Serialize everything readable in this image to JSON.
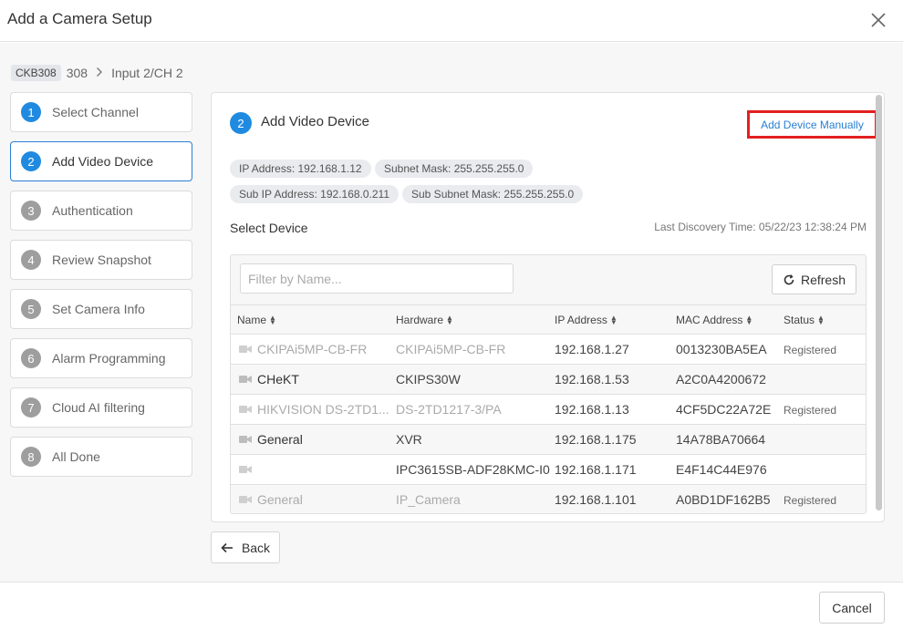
{
  "dialog": {
    "title": "Add a Camera Setup",
    "close_icon": "close-icon"
  },
  "breadcrumb": {
    "chip": "CKB308",
    "device": "308",
    "channel": "Input 2/CH 2"
  },
  "steps": [
    {
      "num": "1",
      "label": "Select Channel",
      "state": "done"
    },
    {
      "num": "2",
      "label": "Add Video Device",
      "state": "active"
    },
    {
      "num": "3",
      "label": "Authentication",
      "state": "pending"
    },
    {
      "num": "4",
      "label": "Review Snapshot",
      "state": "pending"
    },
    {
      "num": "5",
      "label": "Set Camera Info",
      "state": "pending"
    },
    {
      "num": "6",
      "label": "Alarm Programming",
      "state": "pending"
    },
    {
      "num": "7",
      "label": "Cloud AI filtering",
      "state": "pending"
    },
    {
      "num": "8",
      "label": "All Done",
      "state": "pending"
    }
  ],
  "panel": {
    "step_num": "2",
    "title": "Add Video Device",
    "manual_link": "Add Device Manually",
    "chips": {
      "ip": "IP Address: 192.168.1.12",
      "subnet": "Subnet Mask: 255.255.255.0",
      "sub_ip": "Sub IP Address: 192.168.0.211",
      "sub_subnet": "Sub Subnet Mask: 255.255.255.0"
    },
    "select_device": "Select Device",
    "last_discovery": "Last Discovery Time: 05/22/23 12:38:24 PM",
    "filter_placeholder": "Filter by Name...",
    "refresh_label": "Refresh",
    "columns": {
      "name": "Name",
      "hardware": "Hardware",
      "ip": "IP Address",
      "mac": "MAC Address",
      "status": "Status"
    },
    "rows": [
      {
        "name": "CKIPAi5MP-CB-FR",
        "hardware": "CKIPAi5MP-CB-FR",
        "ip": "192.168.1.27",
        "mac": "0013230BA5EA",
        "status": "Registered"
      },
      {
        "name": "CHeKT",
        "hardware": "CKIPS30W",
        "ip": "192.168.1.53",
        "mac": "A2C0A4200672",
        "status": ""
      },
      {
        "name": "HIKVISION DS-2TD1...",
        "hardware": "DS-2TD1217-3/PA",
        "ip": "192.168.1.13",
        "mac": "4CF5DC22A72E",
        "status": "Registered"
      },
      {
        "name": "General",
        "hardware": "XVR",
        "ip": "192.168.1.175",
        "mac": "14A78BA70664",
        "status": ""
      },
      {
        "name": "",
        "hardware": "IPC3615SB-ADF28KMC-I0",
        "ip": "192.168.1.171",
        "mac": "E4F14C44E976",
        "status": ""
      },
      {
        "name": "General",
        "hardware": "IP_Camera",
        "ip": "192.168.1.101",
        "mac": "A0BD1DF162B5",
        "status": "Registered"
      }
    ]
  },
  "footer": {
    "back_label": "Back",
    "cancel_label": "Cancel"
  },
  "colors": {
    "accent": "#1f8ae0",
    "link": "#2a7fd4",
    "highlight": "#e32020",
    "muted": "#aaaaaa"
  }
}
